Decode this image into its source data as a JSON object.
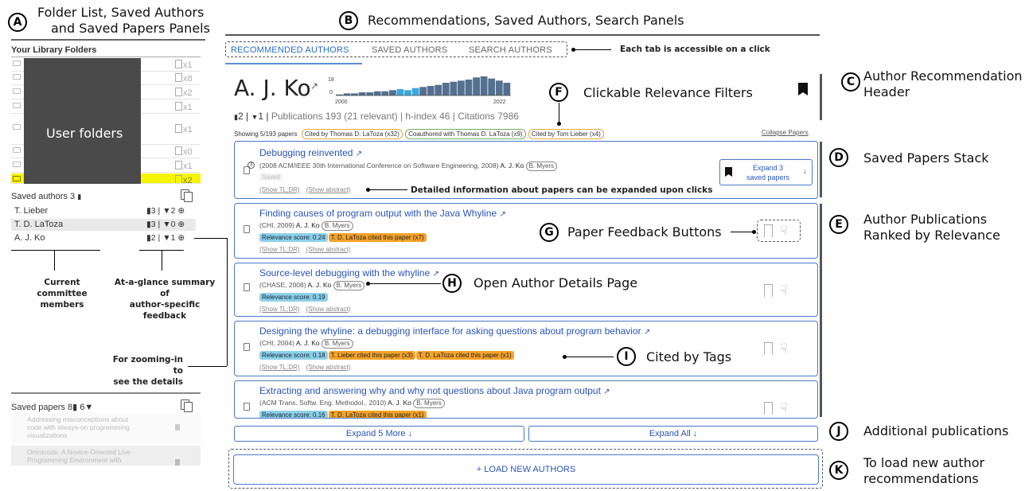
{
  "annotations": {
    "A": {
      "letter": "A",
      "line1": "Folder List, Saved Authors",
      "line2": "and Saved Papers Panels"
    },
    "B": {
      "letter": "B",
      "text": "Recommendations, Saved Authors, Search Panels"
    },
    "C": {
      "letter": "C",
      "line1": "Author Recommendation",
      "line2": "Header"
    },
    "D": {
      "letter": "D",
      "text": "Saved Papers Stack"
    },
    "E": {
      "letter": "E",
      "line1": "Author Publications",
      "line2": "Ranked by Relevance"
    },
    "F": {
      "letter": "F",
      "text": "Clickable Relevance Filters"
    },
    "G": {
      "letter": "G",
      "text": "Paper Feedback Buttons"
    },
    "H": {
      "letter": "H",
      "text": "Open Author Details Page"
    },
    "I": {
      "letter": "I",
      "text": "Cited by Tags"
    },
    "J": {
      "letter": "J",
      "text": "Additional publications"
    },
    "K": {
      "letter": "K",
      "line1": "To load new author",
      "line2": "recommendations"
    },
    "tabs_note": "Each tab is accessible on a click",
    "details_note": "Detailed information about papers can be expanded upon clicks",
    "committee_note_1": "Current committee",
    "committee_note_2": "members",
    "summary_note_1": "At-a-glance summary of",
    "summary_note_2": "author-specific feedback",
    "zoom_note_1": "For zooming-in to",
    "zoom_note_2": "see the details",
    "user_folders": "User folders"
  },
  "left_panel": {
    "library_title": "Your Library Folders",
    "folder_counts": [
      "x1",
      "x8",
      "x2",
      "x1",
      "x1",
      "x0",
      "x1",
      "x2"
    ],
    "saved_authors_label": "Saved authors",
    "saved_authors_count": "3",
    "saved_authors": [
      {
        "name": "T. Lieber",
        "feedback": "3 | ",
        "neg": "2"
      },
      {
        "name": "T. D. LaToza",
        "feedback": "3 | ",
        "neg": "0"
      },
      {
        "name": "A. J. Ko",
        "feedback": "2 | ",
        "neg": "1"
      }
    ],
    "saved_papers_label": "Saved papers",
    "saved_papers_pos": "8",
    "saved_papers_neg": "6",
    "saved_papers": [
      {
        "line1": "Addressing misconceptions about",
        "line2": "code with always-on programming",
        "line3": "visualizations"
      },
      {
        "line1": "Omnicode: A Novice-Oriented Live",
        "line2": "Programming Environment with"
      }
    ]
  },
  "tabs": [
    "RECOMMENDED AUTHORS",
    "SAVED AUTHORS",
    "SEARCH AUTHORS"
  ],
  "author": {
    "name": "A. J. Ko",
    "hist_max": "18",
    "hist_zero": "0",
    "year_start": "2000",
    "year_end": "2022",
    "stats_pos": "2",
    "stats_neg": "1",
    "stats_rest": "Publications 193 (21 relevant) | h-index 46 | Citations 7986",
    "showing": "Showing 5/193 papers",
    "filters": [
      "Cited by Thomas D. LaToza (x32)",
      "Coauthored with Thomas D. LaToza (x9)",
      "Cited by Tom Lieber (x4)"
    ],
    "collapse": "Collapse Papers"
  },
  "saved_paper": {
    "title": "Debugging reinvented",
    "meta": "(2008 ACM/IEEE 30th International Conference on Software Engineering, 2008)",
    "author": "A. J. Ko",
    "coauthor": "B. Myers",
    "badge": "Saved",
    "count": "3",
    "expand_line1": "Expand 3",
    "expand_line2": "saved papers"
  },
  "links": {
    "tldr": "(Show TL;DR)",
    "abstract": "(Show abstract)"
  },
  "papers": [
    {
      "title": "Finding causes of program output with the Java Whyline",
      "meta": "(CHI, 2009)",
      "author": "A. J. Ko",
      "coauthor": "B. Myers",
      "score": "Relevance score: 0.24",
      "cited": [
        "T. D. LaToza cited this paper (x7)"
      ]
    },
    {
      "title": "Source-level debugging with the whyline",
      "meta": "(CHASE, 2008)",
      "author": "A. J. Ko",
      "coauthor": "B. Myers",
      "score": "Relevance score: 0.19",
      "cited": []
    },
    {
      "title": "Designing the whyline: a debugging interface for asking questions about program behavior",
      "meta": "(CHI, 2004)",
      "author": "A. J. Ko",
      "coauthor": "B. Myers",
      "score": "Relevance score: 0.18",
      "cited": [
        "T. Lieber cited this paper (x3)",
        "T. D. LaToza cited this paper (x1)"
      ]
    },
    {
      "title": "Extracting and answering why and why not questions about Java program output",
      "meta": "(ACM Trans. Softw. Eng. Methodol., 2010)",
      "author": "A. J. Ko",
      "coauthor": "B. Myers",
      "score": "Relevance score: 0.16",
      "cited": [
        "T. D. LaToza cited this paper (x1)"
      ]
    }
  ],
  "buttons": {
    "expand_more": "Expand 5 More ↓",
    "expand_all": "Expand All ↓",
    "load_new": "+   LOAD NEW AUTHORS"
  },
  "histogram": [
    1,
    2,
    2,
    3,
    3,
    4,
    4,
    5,
    6,
    5,
    7,
    8,
    9,
    10,
    12,
    13,
    14,
    15,
    17,
    18,
    16,
    14,
    12
  ],
  "histogram_highlight": [
    8,
    9,
    10
  ]
}
